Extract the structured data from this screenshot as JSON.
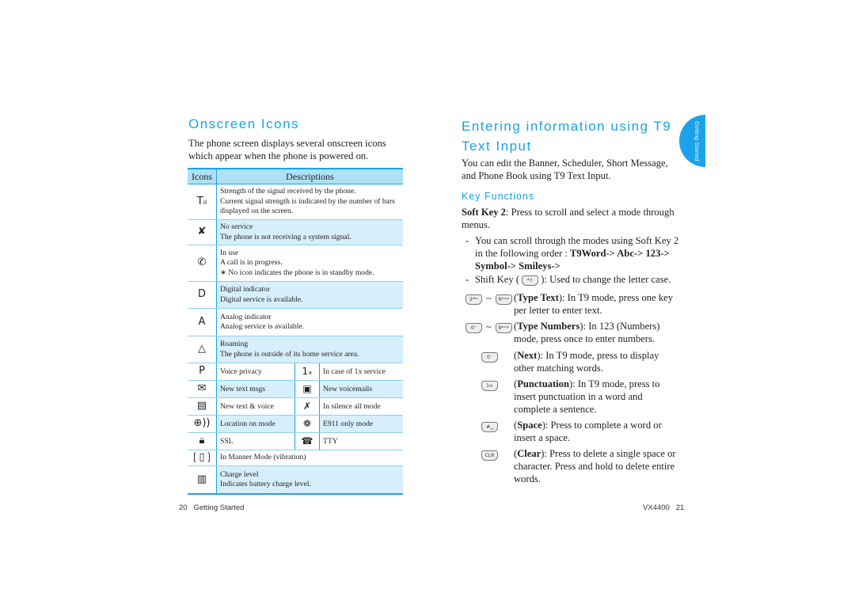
{
  "left_page": {
    "title": "Onscreen Icons",
    "intro": "The phone screen displays several onscreen icons which appear when the phone is powered on.",
    "table": {
      "headers": [
        "Icons",
        "Descriptions"
      ],
      "rows": [
        {
          "icon": "signal-strength-icon",
          "glyph": "Tᵢₗ",
          "lines": [
            "Strength of the signal received by the phone.",
            "Current signal strength is indicated by the number of bars displayed on the screen."
          ]
        },
        {
          "icon": "no-service-icon",
          "glyph": "✘",
          "lines": [
            "No service",
            "The phone is not receiving a system signal."
          ]
        },
        {
          "icon": "in-use-icon",
          "glyph": "✆",
          "lines": [
            "In use",
            "A call is in progress.",
            "∗ No icon indicates the phone is in standby mode."
          ]
        },
        {
          "icon": "digital-indicator-icon",
          "glyph": "D",
          "lines": [
            "Digital indicator",
            "Digital service is available."
          ]
        },
        {
          "icon": "analog-indicator-icon",
          "glyph": "A",
          "lines": [
            "Analog indicator",
            "Analog service is available."
          ]
        },
        {
          "icon": "roaming-icon",
          "glyph": "△",
          "lines": [
            "Roaming",
            "The phone is outside of its home service area."
          ]
        }
      ],
      "pair_rows": [
        {
          "left": {
            "icon": "voice-privacy-icon",
            "glyph": "P",
            "label": "Voice privacy"
          },
          "right": {
            "icon": "1x-service-icon",
            "glyph": "1ₓ",
            "label": "In case of 1x service"
          }
        },
        {
          "left": {
            "icon": "new-text-msgs-icon",
            "glyph": "✉",
            "label": "New text msgs"
          },
          "right": {
            "icon": "new-voicemails-icon",
            "glyph": "▣",
            "label": "New voicemails"
          }
        },
        {
          "left": {
            "icon": "new-text-voice-icon",
            "glyph": "▤",
            "label": "New text & voice"
          },
          "right": {
            "icon": "silence-all-icon",
            "glyph": "✗",
            "label": "In silence all mode"
          }
        },
        {
          "left": {
            "icon": "location-on-icon",
            "glyph": "⊕))",
            "label": "Location on mode"
          },
          "right": {
            "icon": "e911-only-icon",
            "glyph": "❁",
            "label": "E911 only mode"
          }
        },
        {
          "left": {
            "icon": "ssl-lock-icon",
            "glyph": "🔒︎",
            "label": "SSL"
          },
          "right": {
            "icon": "tty-icon",
            "glyph": "☎",
            "label": "TTY"
          }
        }
      ],
      "tail_rows": [
        {
          "icon": "manner-mode-vibration-icon",
          "glyph": "❲▯❳",
          "lines": [
            "In Manner Mode (vibration)"
          ]
        },
        {
          "icon": "battery-charge-icon",
          "glyph": "▥",
          "lines": [
            "Charge level",
            "Indicates battery charge level."
          ]
        }
      ]
    },
    "footer": {
      "page_number": "20",
      "section": "Getting Started"
    }
  },
  "right_page": {
    "title": "Entering information using T9 Text Input",
    "intro": "You can edit the Banner, Scheduler, Short Message, and Phone Book using T9 Text Input.",
    "key_functions_heading": "Key Functions",
    "soft_key": {
      "label": "Soft Key 2",
      "text": ": Press to scroll and select a mode through menus."
    },
    "bullets": [
      {
        "dash": "-",
        "text_pre": "You can scroll through the modes using Soft Key 2 in the following order : ",
        "bold": "T9Word-> Abc-> 123-> Symbol-> Smileys->"
      },
      {
        "dash": "-",
        "text_pre": "Shift Key (",
        "key": "*⇧",
        "text_post": "): Used to change the letter case."
      }
    ],
    "key_items": [
      {
        "keys": [
          "2ᵃᵇᶜ",
          "9ʷˣʸᶻ"
        ],
        "sep": "~",
        "bold": "Type Text",
        "text": "): In T9 mode, press one key per letter to enter text."
      },
      {
        "keys": [
          "0⁻",
          "9ʷˣʸᶻ"
        ],
        "sep": "~",
        "bold": "Type Numbers",
        "text": "): In 123 (Numbers) mode, press once to enter numbers."
      },
      {
        "keys": [
          "0⁻"
        ],
        "bold": "Next",
        "text": "): In T9 mode, press to display other matching words."
      },
      {
        "keys": [
          "1∞"
        ],
        "bold": "Punctuation",
        "text": "): In T9 mode, press to insert punctuation in a word and complete a sentence."
      },
      {
        "keys": [
          "#␣"
        ],
        "bold": "Space",
        "text": "): Press to complete a word or insert a space."
      },
      {
        "keys": [
          "CLR"
        ],
        "bold": "Clear",
        "text": "): Press to delete a single space or character. Press and hold to delete entire words."
      }
    ],
    "side_tab": "Getting Started",
    "footer": {
      "model": "VX4400",
      "page_number": "21"
    }
  },
  "colors": {
    "accent": "#1aa3e8",
    "table_header": "#aee0f7",
    "row_shade": "#d6effb"
  }
}
